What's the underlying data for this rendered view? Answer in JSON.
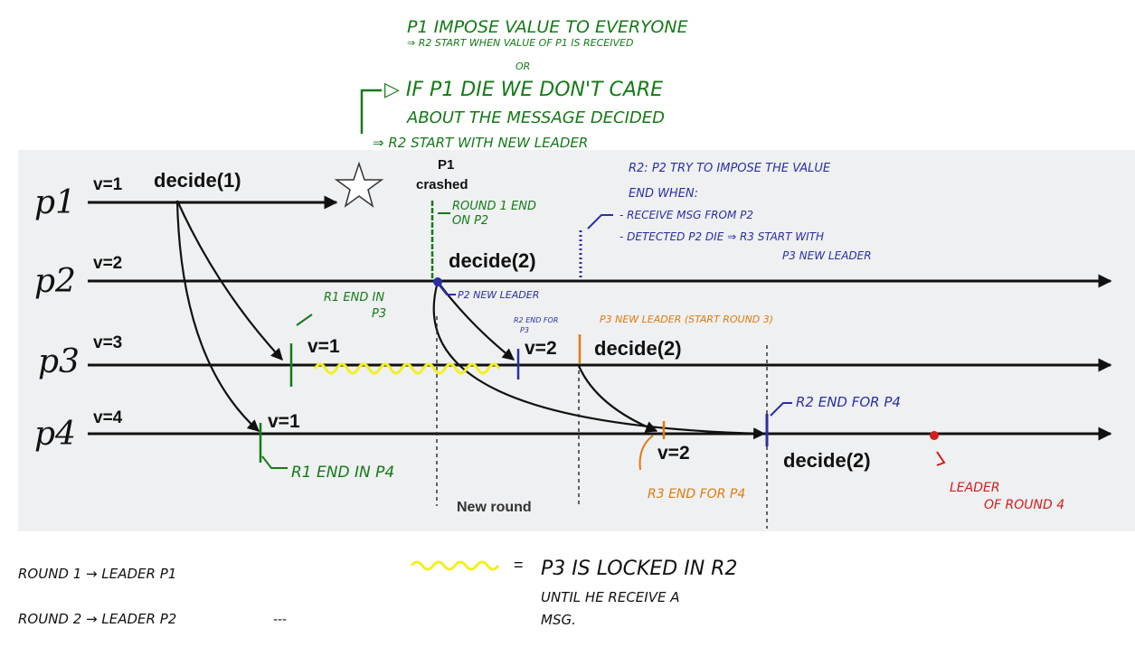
{
  "top_notes": {
    "line1": "P1 IMPOSE VALUE TO EVERYONE",
    "line2": "⇒ R2 START WHEN VALUE OF P1 IS RECEIVED",
    "line3": "OR",
    "line4": "▷ IF P1 DIE WE DON'T CARE",
    "line5": "ABOUT THE MESSAGE DECIDED",
    "line6": "⇒ R2 START WITH NEW LEADER"
  },
  "processes": {
    "p1": {
      "label": "p1",
      "value": "v=1",
      "decide": "decide(1)"
    },
    "p2": {
      "label": "p2",
      "value": "v=2",
      "decide": "decide(2)"
    },
    "p3": {
      "label": "p3",
      "value": "v=3",
      "recv1": "v=1",
      "recv2": "v=2",
      "decide": "decide(2)"
    },
    "p4": {
      "label": "p4",
      "value": "v=4",
      "recv1": "v=1",
      "recv2": "v=2",
      "decide": "decide(2)"
    }
  },
  "printed_labels": {
    "crashed_top": "P1",
    "crashed_bottom": "crashed",
    "new_round": "New round"
  },
  "annotations": {
    "round1_end_p2_a": "ROUND 1 END",
    "round1_end_p2_b": "ON P2",
    "p2_new_leader": "P2 NEW LEADER",
    "r1_end_p3_a": "R1 END IN",
    "r1_end_p3_b": "P3",
    "r2_end_p3_a": "R2 END FOR",
    "r2_end_p3_b": "P3",
    "p3_new_leader": "P3 NEW LEADER (START ROUND 3)",
    "r1_end_p4": "R1 END IN P4",
    "r2_end_p4": "R2 END FOR P4",
    "r3_end_p4": "R3 END FOR P4",
    "leader_round4_a": "LEADER",
    "leader_round4_b": "OF ROUND 4",
    "r2_block_1": "R2: P2 TRY TO IMPOSE THE VALUE",
    "r2_block_2": "END WHEN:",
    "r2_block_3": "- RECEIVE MSG FROM P2",
    "r2_block_4": "- DETECTED P2 DIE ⇒ R3 START WITH",
    "r2_block_5": "P3 NEW LEADER"
  },
  "bottom_notes": {
    "round1": "ROUND 1 → LEADER P1",
    "round2": "ROUND 2 → LEADER P2",
    "round2_ellipsis": "---",
    "legend_eq": "=",
    "legend_1": "P3 IS LOCKED IN R2",
    "legend_2": "UNTIL HE RECEIVE A",
    "legend_3": "MSG."
  },
  "colors": {
    "panel": "#eef0f1",
    "green": "#157a18",
    "blue": "#2b2fa3",
    "orange": "#e07a10",
    "red": "#d41c1c",
    "yellow": "#f2f01e"
  },
  "icons": [
    "crash-star-icon"
  ]
}
